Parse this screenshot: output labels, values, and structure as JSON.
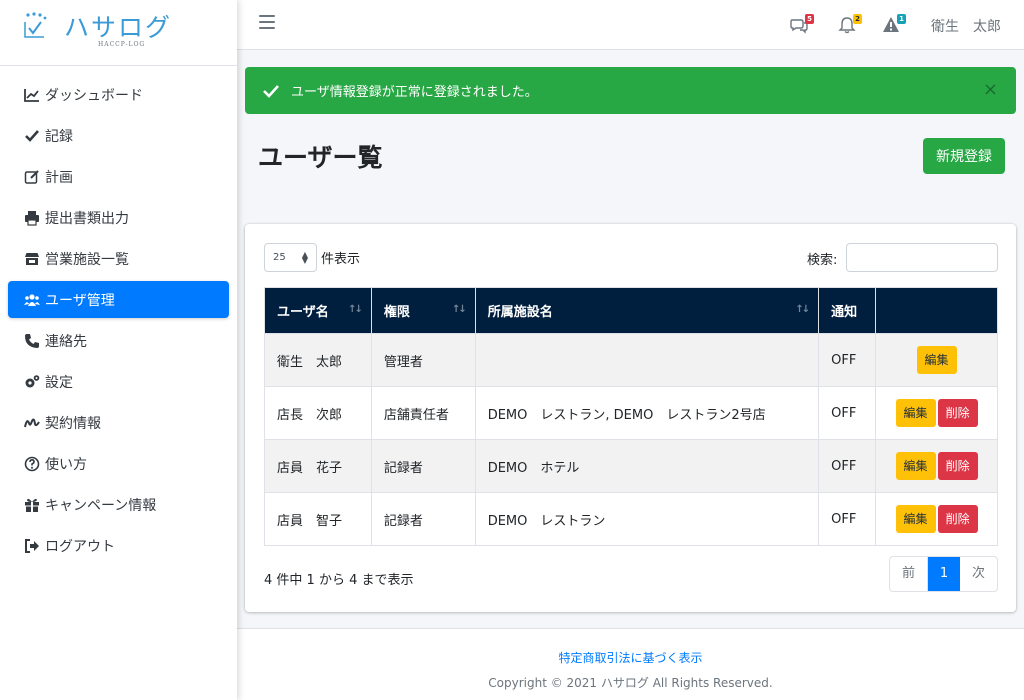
{
  "brand": {
    "name": "ハサログ",
    "sub": "HACCP-LOG"
  },
  "sidebar": {
    "items": [
      {
        "label": "ダッシュボード",
        "icon": "chart-line-icon"
      },
      {
        "label": "記録",
        "icon": "check-icon"
      },
      {
        "label": "計画",
        "icon": "edit-icon"
      },
      {
        "label": "提出書類出力",
        "icon": "print-icon"
      },
      {
        "label": "営業施設一覧",
        "icon": "store-icon"
      },
      {
        "label": "ユーザ管理",
        "icon": "users-icon",
        "active": true
      },
      {
        "label": "連絡先",
        "icon": "phone-icon"
      },
      {
        "label": "設定",
        "icon": "cogs-icon"
      },
      {
        "label": "契約情報",
        "icon": "signature-icon"
      },
      {
        "label": "使い方",
        "icon": "question-circle-icon"
      },
      {
        "label": "キャンペーン情報",
        "icon": "gift-icon"
      },
      {
        "label": "ログアウト",
        "icon": "sign-out-icon"
      }
    ]
  },
  "topbar": {
    "messages_count": "5",
    "notifications_count": "2",
    "alerts_count": "1",
    "username": "衛生　太郎"
  },
  "alert": {
    "message": "ユーザ情報登録が正常に登録されました。",
    "close": "×"
  },
  "page": {
    "title": "ユーザー覧",
    "new_button": "新規登録"
  },
  "table_controls": {
    "page_length": "25",
    "length_label": "件表示",
    "search_label": "検索:",
    "search_value": ""
  },
  "table": {
    "headers": [
      "ユーザ名",
      "権限",
      "所属施設名",
      "通知",
      ""
    ],
    "rows": [
      {
        "name": "衛生　太郎",
        "role": "管理者",
        "facility": "",
        "notify": "OFF",
        "edit": "編集",
        "delete": ""
      },
      {
        "name": "店長　次郎",
        "role": "店舗責任者",
        "facility": "DEMO　レストラン, DEMO　レストラン2号店",
        "notify": "OFF",
        "edit": "編集",
        "delete": "削除"
      },
      {
        "name": "店員　花子",
        "role": "記録者",
        "facility": "DEMO　ホテル",
        "notify": "OFF",
        "edit": "編集",
        "delete": "削除"
      },
      {
        "name": "店員　智子",
        "role": "記録者",
        "facility": "DEMO　レストラン",
        "notify": "OFF",
        "edit": "編集",
        "delete": "削除"
      }
    ]
  },
  "pagination": {
    "info": "4 件中 1 から 4 まで表示",
    "prev": "前",
    "current": "1",
    "next": "次"
  },
  "footer": {
    "link": "特定商取引法に基づく表示",
    "copyright": "Copyright © 2021 ハサログ All Rights Reserved."
  },
  "colors": {
    "primary": "#007bff",
    "success": "#28a745",
    "warning": "#ffc107",
    "danger": "#dc3545",
    "info": "#17a2b8",
    "table_header": "#001f3f"
  }
}
